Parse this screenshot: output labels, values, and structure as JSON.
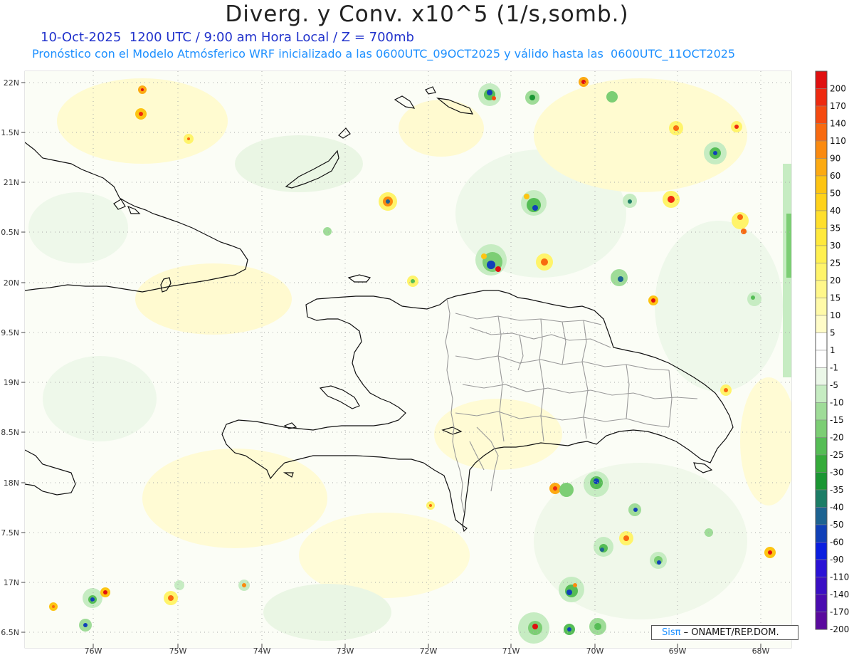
{
  "header": {
    "title": "Diverg. y Conv. x10^5 (1/s,somb.)",
    "subtitle": "10-Oct-2025  1200 UTC / 9:00 am Hora Local / Z = 700mb",
    "forecast": "Pronóstico con el Modelo Atmósferico WRF inicializado a las 0600UTC_09OCT2025 y válido hasta las  0600UTC_11OCT2025"
  },
  "map": {
    "lat_labels": [
      "22N",
      "1.5N",
      "21N",
      "0.5N",
      "20N",
      "9.5N",
      "19N",
      "8.5N",
      "18N",
      "7.5N",
      "17N",
      "6.5N"
    ],
    "lon_labels": [
      "76W",
      "75W",
      "74W",
      "73W",
      "72W",
      "71W",
      "70W",
      "69W",
      "68W"
    ]
  },
  "colorbar": {
    "labels": [
      "200",
      "170",
      "140",
      "110",
      "90",
      "60",
      "50",
      "40",
      "35",
      "30",
      "25",
      "20",
      "15",
      "10",
      "5",
      "1",
      "-1",
      "-5",
      "-10",
      "-15",
      "-20",
      "-25",
      "-30",
      "-35",
      "-40",
      "-50",
      "-60",
      "-90",
      "-110",
      "-140",
      "-170",
      "-200"
    ],
    "colors": [
      "#e01010",
      "#ee2a10",
      "#f54a10",
      "#f86a10",
      "#fa8a10",
      "#fcaa12",
      "#fdc412",
      "#ffd21a",
      "#ffdf2c",
      "#ffe93c",
      "#fff050",
      "#fff46a",
      "#fff78a",
      "#fffaa8",
      "#fffcc8",
      "#ffffff",
      "#ffffff",
      "#ebf7e8",
      "#c6ecc2",
      "#9fdc98",
      "#7cce74",
      "#55bd55",
      "#35ab3a",
      "#1a9633",
      "#1c7d66",
      "#1d6391",
      "#1040b8",
      "#0a1ee0",
      "#2a12d6",
      "#3a0fc4",
      "#4a0cb0",
      "#5a0a9e"
    ]
  },
  "credit": {
    "logo": "Sisπ",
    "text": " – ONAMET/REP.DOM."
  }
}
